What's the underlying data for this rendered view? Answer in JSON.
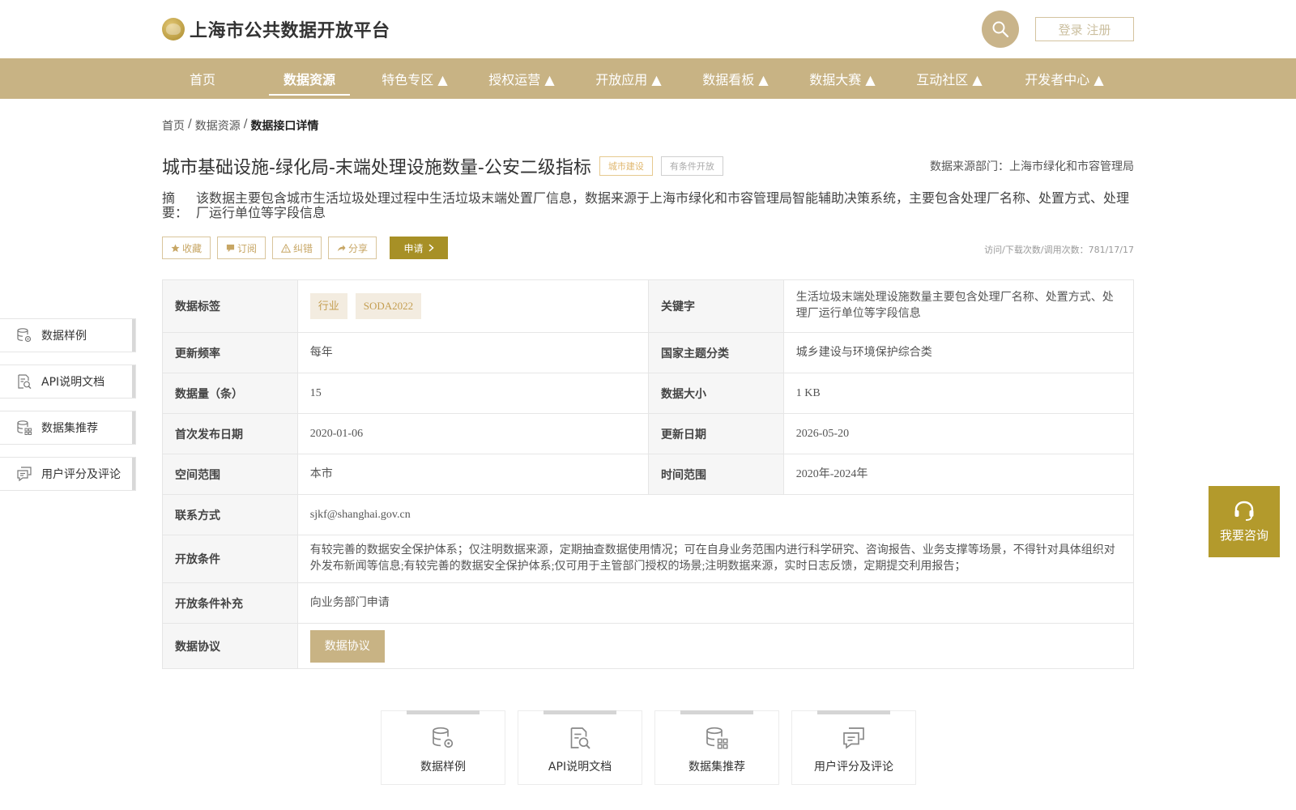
{
  "header": {
    "site_title": "上海市公共数据开放平台",
    "login_label": "登录 注册",
    "icons": {
      "logo": "city-emblem-icon",
      "search": "search-icon"
    }
  },
  "nav": {
    "items": [
      {
        "label": "首页"
      },
      {
        "label": "数据资源",
        "active": true
      },
      {
        "label": "特色专区 ▲"
      },
      {
        "label": "授权运营 ▲"
      },
      {
        "label": "开放应用 ▲"
      },
      {
        "label": "数据看板 ▲"
      },
      {
        "label": "数据大赛 ▲"
      },
      {
        "label": "互动社区 ▲"
      },
      {
        "label": "开发者中心 ▲"
      }
    ]
  },
  "breadcrumb": {
    "home": "首页",
    "sep": "/",
    "resources": "数据资源",
    "current": "数据接口详情"
  },
  "detail": {
    "title": "城市基础设施-绿化局-末端处理设施数量-公安二级指标",
    "tag_category": "城市建设",
    "tag_open": "有条件开放",
    "source": "数据来源部门：上海市绿化和市容管理局",
    "summary_label": "摘 要：",
    "summary_text": "该数据主要包含城市生活垃圾处理过程中生活垃圾末端处置厂信息，数据来源于上海市绿化和市容管理局智能辅助决策系统，主要包含处理厂名称、处置方式、处理厂运行单位等字段信息"
  },
  "actions": {
    "favorite": "收藏",
    "subscribe": "订阅",
    "report": "纠错",
    "share": "分享",
    "apply": "申请",
    "counts": "访问/下载次数/调用次数：781/17/17"
  },
  "table": {
    "tags_label": "数据标签",
    "tags": [
      "行业",
      "SODA2022"
    ],
    "keywords_label": "关键字",
    "keywords": "生活垃圾末端处理设施数量主要包含处理厂名称、处置方式、处理厂运行单位等字段信息",
    "freq_label": "更新频率",
    "freq": "每年",
    "theme_label": "国家主题分类",
    "theme": "城乡建设与环境保护综合类",
    "count_label": "数据量（条）",
    "count": "15",
    "size_label": "数据大小",
    "size": "1 KB",
    "first_pub_label": "首次发布日期",
    "first_pub": "2020-01-06",
    "update_label": "更新日期",
    "update": "2026-05-20",
    "space_label": "空间范围",
    "space": "本市",
    "time_label": "时间范围",
    "time": "2020年-2024年",
    "contact_label": "联系方式",
    "contact": "sjkf@shanghai.gov.cn",
    "conditions_label": "开放条件",
    "conditions": "有较完善的数据安全保护体系；仅注明数据来源，定期抽查数据使用情况；可在自身业务范围内进行科学研究、咨询报告、业务支撑等场景，不得针对具体组织对外发布新闻等信息;有较完善的数据安全保护体系;仅可用于主管部门授权的场景;注明数据来源，实时日志反馈，定期提交利用报告；",
    "supplement_label": "开放条件补充",
    "supplement": "向业务部门申请",
    "protocol_label": "数据协议",
    "protocol_btn": "数据协议"
  },
  "side_nav": [
    {
      "label": "数据样例",
      "icon": "database-gear-icon"
    },
    {
      "label": "API说明文档",
      "icon": "document-search-icon"
    },
    {
      "label": "数据集推荐",
      "icon": "database-grid-icon"
    },
    {
      "label": "用户评分及评论",
      "icon": "comment-icon"
    }
  ],
  "consult": {
    "label": "我要咨询",
    "icon": "headset-icon"
  },
  "bottom_cards": [
    {
      "label": "数据样例",
      "icon": "database-gear-icon"
    },
    {
      "label": "API说明文档",
      "icon": "document-search-icon"
    },
    {
      "label": "数据集推荐",
      "icon": "database-grid-icon"
    },
    {
      "label": "用户评分及评论",
      "icon": "comment-icon"
    }
  ],
  "colors": {
    "nav_bg": "#c8b384",
    "apply_btn": "#a79026",
    "consult_bg": "#b39a2c",
    "chip_text": "#c49e51"
  }
}
